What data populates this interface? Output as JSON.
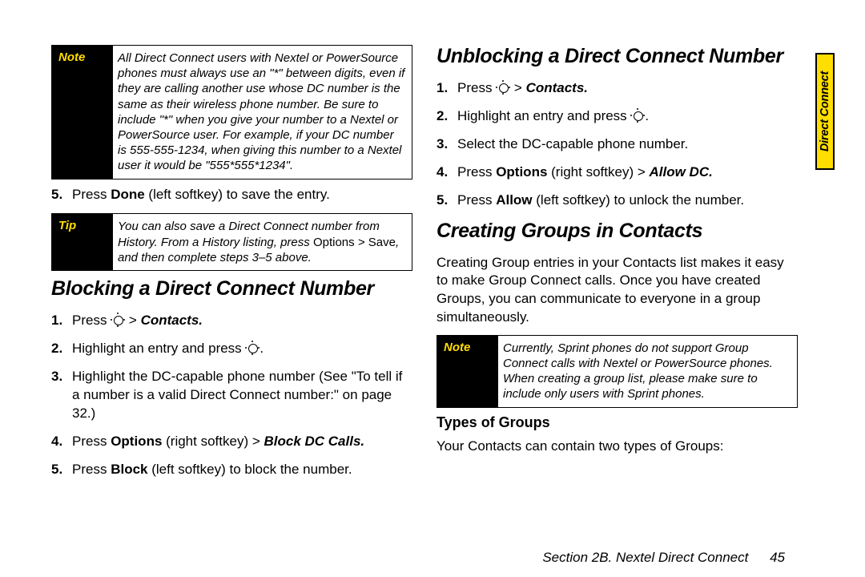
{
  "sideTab": "Direct Connect",
  "footer": {
    "section": "Section 2B. Nextel Direct Connect",
    "page": "45"
  },
  "left": {
    "note1Label": "Note",
    "note1": "All Direct Connect users with Nextel or PowerSource phones must always use an \"*\" between digits, even if they are calling another use whose DC number is the same as their wireless phone number. Be sure to include \"*\" when you give your number to a Nextel or PowerSource user. For example, if your DC number is 555-555-1234, when giving this number to a Nextel user it would be \"555*555*1234\".",
    "step5_pre": "Press ",
    "step5_b": "Done",
    "step5_post": " (left softkey) to save the entry.",
    "tipLabel": "Tip",
    "tip_pre": "You can also save a Direct Connect number from History. From a History listing, press ",
    "tip_opt1": "Options",
    "tip_mid": " > ",
    "tip_opt2": "Save",
    "tip_post": ", and then complete steps 3–5 above.",
    "h_block": "Blocking a Direct Connect Number",
    "b1_pre": "Press ",
    "b1_gt": " > ",
    "b1_bi": "Contacts.",
    "b2_pre": "Highlight an entry and press ",
    "b2_post": ".",
    "b3": "Highlight the DC-capable phone number (See \"To tell if a number is a valid Direct Connect number:\" on page 32.)",
    "b4_pre": "Press ",
    "b4_b1": "Options",
    "b4_mid": " (right softkey) > ",
    "b4_bi": "Block DC Calls.",
    "b5_pre": "Press ",
    "b5_b": "Block",
    "b5_post": " (left softkey) to block the number."
  },
  "right": {
    "h_unblock": "Unblocking a Direct Connect Number",
    "u1_pre": "Press ",
    "u1_gt": " > ",
    "u1_bi": "Contacts.",
    "u2_pre": "Highlight an entry and press ",
    "u2_post": ".",
    "u3": "Select the DC-capable phone number.",
    "u4_pre": "Press ",
    "u4_b1": "Options",
    "u4_mid": " (right softkey) > ",
    "u4_bi": "Allow DC.",
    "u5_pre": "Press ",
    "u5_b": "Allow",
    "u5_post": " (left softkey) to unlock the number.",
    "h_groups": "Creating Groups in Contacts",
    "groups_para": "Creating Group entries in your Contacts list makes it easy to make Group Connect calls. Once you have created Groups, you can communicate to everyone in a group simultaneously.",
    "note2Label": "Note",
    "note2": "Currently, Sprint phones do not support Group Connect calls with Nextel or PowerSource phones. When creating a group list, please make sure to include only users with Sprint phones.",
    "h_types": "Types of Groups",
    "types_para": "Your Contacts can contain two types of Groups:"
  }
}
